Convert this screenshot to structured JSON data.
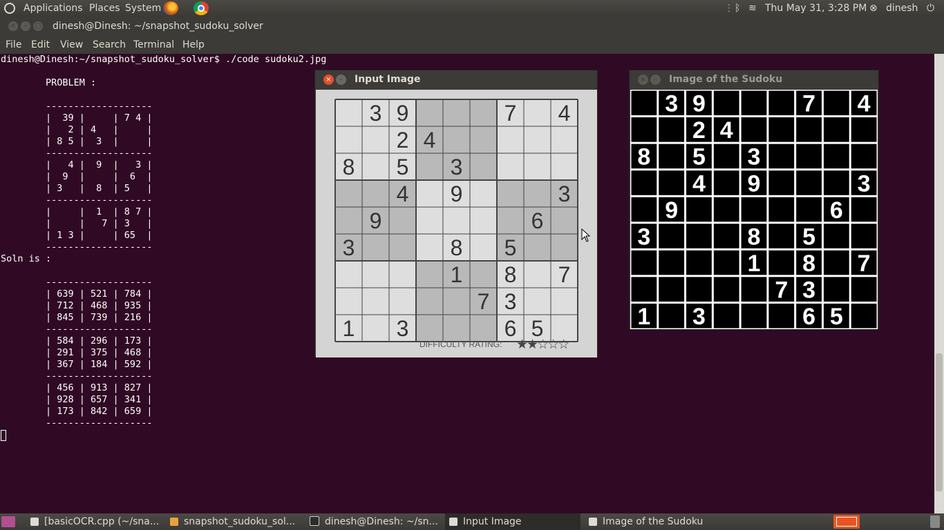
{
  "top_panel": {
    "menus": [
      "Applications",
      "Places",
      "System"
    ],
    "clock": "Thu May 31,  3:28 PM",
    "user": "dinesh"
  },
  "terminal": {
    "title": "dinesh@Dinesh: ~/snapshot_sudoku_solver",
    "menu": [
      "File",
      "Edit",
      "View",
      "Search",
      "Terminal",
      "Help"
    ],
    "output": "dinesh@Dinesh:~/snapshot_sudoku_solver$ ./code sudoku2.jpg\n\n        PROBLEM :\n\n        -------------------\n        |  39 |     | 7 4 |\n        |   2 | 4   |     |\n        | 8 5 |  3  |     |\n        -------------------\n        |   4 |  9  |   3 |\n        |  9  |     |  6  |\n        | 3   |  8  | 5   |\n        -------------------\n        |     |  1  | 8 7 |\n        |     |   7 | 3   |\n        | 1 3 |     | 65  |\n        -------------------\nSoln is :\n\n        -------------------\n        | 639 | 521 | 784 |\n        | 712 | 468 | 935 |\n        | 845 | 739 | 216 |\n        -------------------\n        | 584 | 296 | 173 |\n        | 291 | 375 | 468 |\n        | 367 | 184 | 592 |\n        -------------------\n        | 456 | 913 | 827 |\n        | 928 | 657 | 341 |\n        | 173 | 842 | 659 |\n        -------------------"
  },
  "input_window": {
    "title": "Input Image",
    "difficulty_label": "DIFFICULTY RATING:",
    "difficulty_stars": 2,
    "difficulty_max": 5
  },
  "sudoku_window": {
    "title": "Image of the Sudoku"
  },
  "sudoku_grid": [
    [
      0,
      3,
      9,
      0,
      0,
      0,
      7,
      0,
      4
    ],
    [
      0,
      0,
      2,
      4,
      0,
      0,
      0,
      0,
      0
    ],
    [
      8,
      0,
      5,
      0,
      3,
      0,
      0,
      0,
      0
    ],
    [
      0,
      0,
      4,
      0,
      9,
      0,
      0,
      0,
      3
    ],
    [
      0,
      9,
      0,
      0,
      0,
      0,
      0,
      6,
      0
    ],
    [
      3,
      0,
      0,
      0,
      8,
      0,
      5,
      0,
      0
    ],
    [
      0,
      0,
      0,
      0,
      1,
      0,
      8,
      0,
      7
    ],
    [
      0,
      0,
      0,
      0,
      0,
      7,
      3,
      0,
      0
    ],
    [
      1,
      0,
      3,
      0,
      0,
      0,
      6,
      5,
      0
    ]
  ],
  "taskbar": {
    "items": [
      "[basicOCR.cpp (~/sna...",
      "snapshot_sudoku_sol...",
      "dinesh@Dinesh: ~/sn...",
      "Input Image",
      "Image of the Sudoku"
    ]
  },
  "colors": {
    "terminal_bg": "#300a24",
    "panel_bg": "#3c3b37",
    "close_button": "#e0502a"
  }
}
